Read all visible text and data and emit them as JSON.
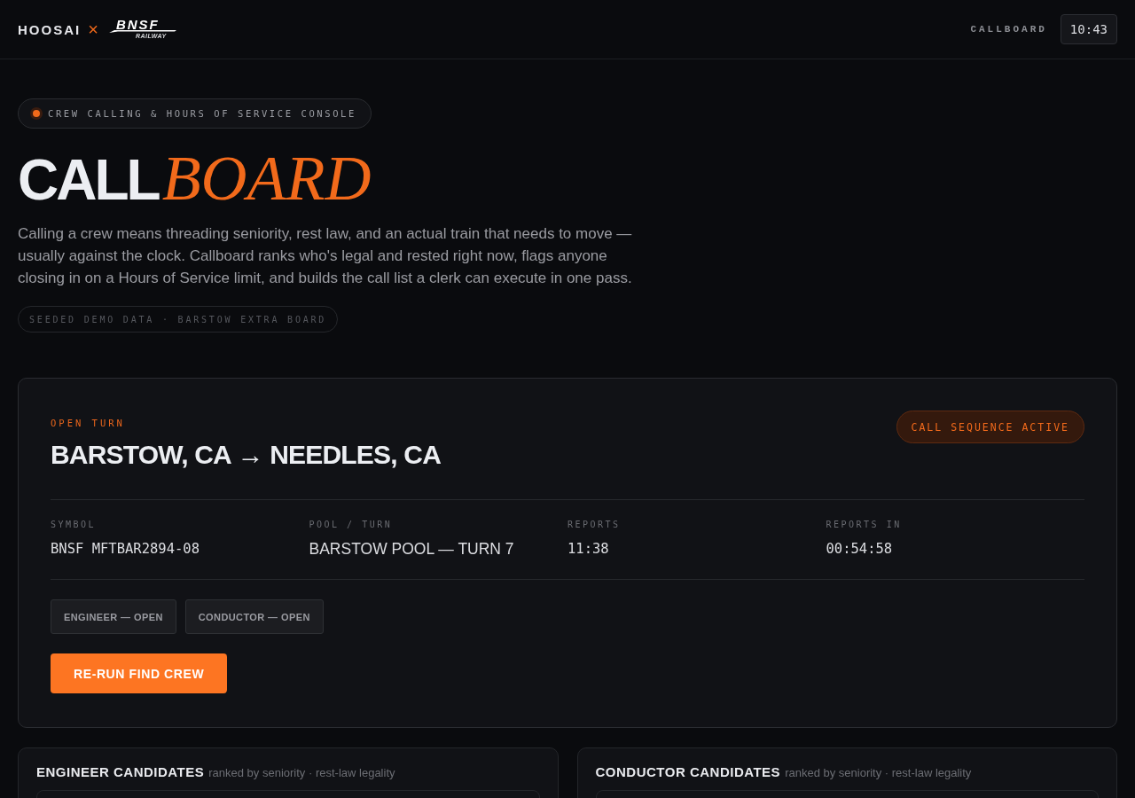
{
  "header": {
    "brand": "HOOSAI",
    "separator": "×",
    "partner_logo": {
      "wordmark": "BNSF",
      "subtitle": "RAILWAY"
    },
    "app_label": "CALLBOARD",
    "clock": "10:43"
  },
  "hero": {
    "eyebrow": "CREW CALLING & HOURS OF SERVICE CONSOLE",
    "title": {
      "plain": "CALL",
      "accent": "BOARD"
    },
    "description": "Calling a crew means threading seniority, rest law, and an actual train that needs to move — usually against the clock. Callboard ranks who's legal and rested right now, flags anyone closing in on a Hours of Service limit, and builds the call list a clerk can execute in one pass.",
    "data_tag": "SEEDED DEMO DATA · BARSTOW EXTRA BOARD"
  },
  "turn_card": {
    "eyebrow": "OPEN TURN",
    "route": "BARSTOW, CA → NEEDLES, CA",
    "status": "CALL SEQUENCE ACTIVE",
    "stats": [
      {
        "label": "SYMBOL",
        "value": "BNSF MFTBAR2894-08",
        "kind": "code"
      },
      {
        "label": "POOL / TURN",
        "value": "BARSTOW POOL — TURN 7",
        "kind": "text"
      },
      {
        "label": "REPORTS",
        "value": "11:38",
        "kind": "code"
      },
      {
        "label": "REPORTS IN",
        "value": "00:54:58",
        "kind": "code"
      }
    ],
    "roles": [
      "ENGINEER — OPEN",
      "CONDUCTOR — OPEN"
    ],
    "action": "RE-RUN FIND CREW"
  },
  "candidate_panels": [
    {
      "title": "ENGINEER CANDIDATES",
      "subtitle": "ranked by seniority · rest-law legality"
    },
    {
      "title": "CONDUCTOR CANDIDATES",
      "subtitle": "ranked by seniority · rest-law legality"
    }
  ]
}
